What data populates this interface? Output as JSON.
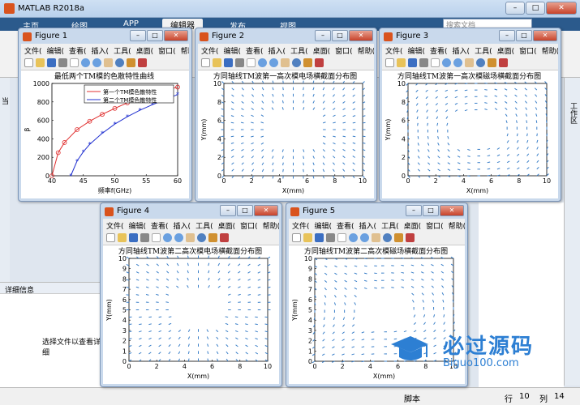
{
  "app": {
    "title": "MATLAB R2018a",
    "ribbon_tabs": [
      "主页",
      "绘图",
      "APP",
      "编辑器",
      "发布",
      "视图"
    ],
    "search_placeholder": "搜索文档",
    "right_panel_label": "工作区",
    "details_header": "详细信息",
    "details_msg": "选择文件以查看详细",
    "status": {
      "mode": "脚本",
      "row_label": "行",
      "row": "10",
      "col_label": "列",
      "col": "14"
    },
    "left_stub": "当"
  },
  "menu": [
    "文件(",
    "编辑(",
    "查看(",
    "插入(",
    "工具(",
    "桌面(",
    "窗口(",
    "帮助("
  ],
  "figures": [
    {
      "title": "Figure 1",
      "plot_title": "最低两个TM模的色散特性曲线",
      "xlabel": "频率f(GHz)",
      "ylabel": "β",
      "legend": [
        "第一个TM模色散特性",
        "第二个TM模色散特性"
      ],
      "xticks": [
        "40",
        "45",
        "50",
        "55",
        "60"
      ],
      "yticks": [
        "0",
        "200",
        "400",
        "600",
        "800",
        "1000"
      ]
    },
    {
      "title": "Figure 2",
      "plot_title": "方同轴线TM波第一高次模电场横截面分布图",
      "xlabel": "X(mm)",
      "ylabel": "Y(mm)",
      "xticks": [
        "0",
        "2",
        "4",
        "6",
        "8",
        "10"
      ],
      "yticks": [
        "0",
        "2",
        "4",
        "6",
        "8",
        "10"
      ]
    },
    {
      "title": "Figure 3",
      "plot_title": "方同轴线TM波第一高次模磁场横截面分布图",
      "xlabel": "X(mm)",
      "ylabel": "Y(mm)",
      "xticks": [
        "0",
        "2",
        "4",
        "6",
        "8",
        "10"
      ],
      "yticks": [
        "0",
        "2",
        "4",
        "6",
        "8",
        "10"
      ]
    },
    {
      "title": "Figure 4",
      "plot_title": "方同轴线TM波第二高次模电场横截面分布图",
      "xlabel": "X(mm)",
      "ylabel": "Y(mm)",
      "xticks": [
        "0",
        "2",
        "4",
        "6",
        "8",
        "10"
      ],
      "yticks": [
        "0",
        "1",
        "2",
        "3",
        "4",
        "5",
        "6",
        "7",
        "8",
        "9",
        "10"
      ]
    },
    {
      "title": "Figure 5",
      "plot_title": "方同轴线TM波第二高次模磁场横截面分布图",
      "xlabel": "X(mm)",
      "ylabel": "Y(mm)",
      "xticks": [
        "0",
        "2",
        "4",
        "6",
        "8",
        "10"
      ],
      "yticks": [
        "0",
        "1",
        "2",
        "3",
        "4",
        "5",
        "6",
        "7",
        "8",
        "9",
        "10"
      ]
    }
  ],
  "chart_data": [
    {
      "type": "line",
      "title": "最低两个TM模的色散特性曲线",
      "xlabel": "频率f(GHz)",
      "ylabel": "β",
      "xlim": [
        40,
        60
      ],
      "ylim": [
        0,
        1000
      ],
      "series": [
        {
          "name": "第一个TM模色散特性",
          "color": "#e03030",
          "marker": "circle",
          "x": [
            40,
            41,
            42,
            44,
            46,
            48,
            50,
            52,
            54,
            56,
            58,
            60
          ],
          "y": [
            0,
            250,
            360,
            500,
            590,
            665,
            730,
            790,
            840,
            885,
            925,
            960
          ]
        },
        {
          "name": "第二个TM模色散特性",
          "color": "#2030d0",
          "marker": "star",
          "x": [
            43,
            44,
            45,
            46,
            48,
            50,
            52,
            54,
            56,
            58,
            60
          ],
          "y": [
            0,
            160,
            260,
            340,
            460,
            560,
            640,
            710,
            770,
            825,
            880
          ]
        }
      ]
    },
    {
      "type": "scatter",
      "title": "方同轴线TM波第一高次模电场横截面分布图",
      "xlim": [
        0,
        10
      ],
      "ylim": [
        0,
        10
      ],
      "pattern": "radial-e"
    },
    {
      "type": "scatter",
      "title": "方同轴线TM波第一高次模磁场横截面分布图",
      "xlim": [
        0,
        10
      ],
      "ylim": [
        0,
        10
      ],
      "pattern": "circulating-h"
    },
    {
      "type": "scatter",
      "title": "方同轴线TM波第二高次模电场横截面分布图",
      "xlim": [
        0,
        10
      ],
      "ylim": [
        0,
        10
      ],
      "pattern": "two-lobe-e"
    },
    {
      "type": "scatter",
      "title": "方同轴线TM波第二高次模磁场横截面分布图",
      "xlim": [
        0,
        10
      ],
      "ylim": [
        0,
        10
      ],
      "pattern": "two-lobe-h"
    }
  ],
  "watermark": {
    "big": "必过源码",
    "small": "Biguo100.com"
  },
  "colors": {
    "quiver": "#3a7fc8",
    "titlebar": "#c9d9ec"
  }
}
